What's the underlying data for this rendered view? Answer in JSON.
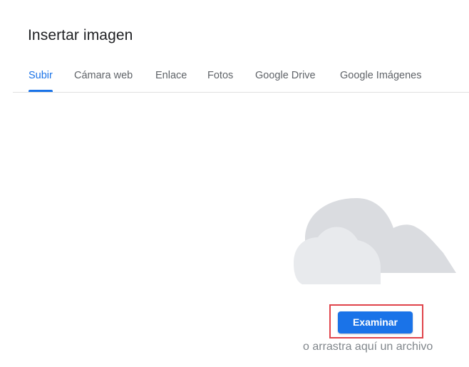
{
  "dialog": {
    "title": "Insertar imagen"
  },
  "tabs": [
    {
      "label": "Subir",
      "active": true
    },
    {
      "label": "Cámara web",
      "active": false
    },
    {
      "label": "Enlace",
      "active": false
    },
    {
      "label": "Fotos",
      "active": false
    },
    {
      "label": "Google Drive",
      "active": false
    },
    {
      "label": "Google Imágenes",
      "active": false
    }
  ],
  "upload": {
    "illustration_icon": "cloud-icon",
    "browse_label": "Examinar",
    "drag_hint": "o arrastra aquí un archivo"
  },
  "colors": {
    "accent": "#1a73e8",
    "highlight": "#e0434a",
    "cloud_back": "#dadce0",
    "cloud_front": "#e8eaed"
  }
}
